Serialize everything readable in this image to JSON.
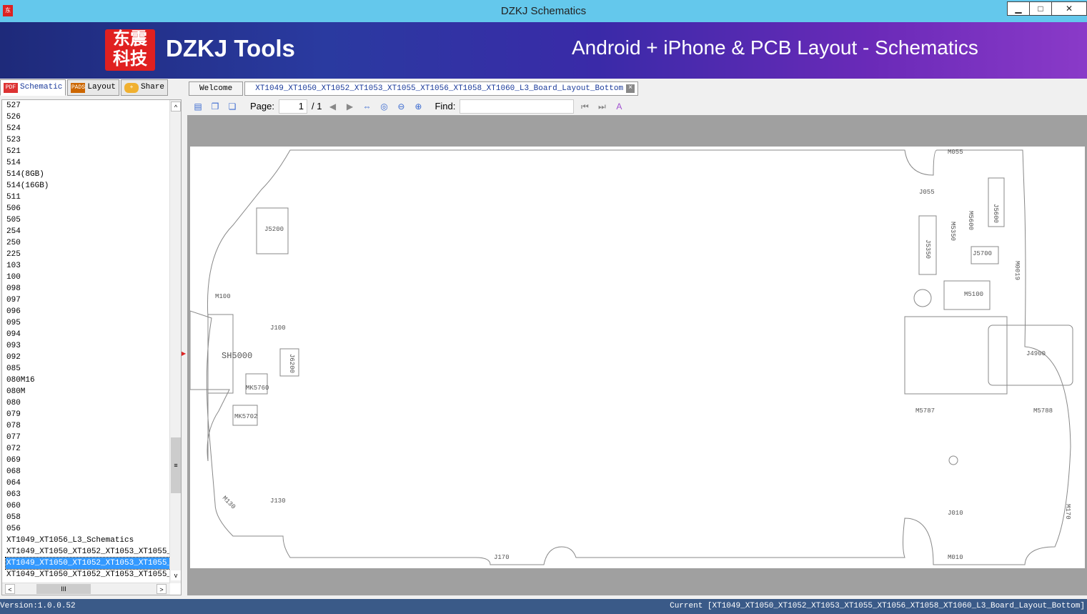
{
  "window": {
    "title": "DZKJ Schematics",
    "app_icon": "dzkj-icon",
    "minimize": "▁",
    "maximize": "□",
    "close": "✕"
  },
  "banner": {
    "logo_text": "东震科技",
    "brand": "DZKJ Tools",
    "slogan": "Android + iPhone & PCB Layout - Schematics"
  },
  "left_tabs": [
    {
      "label": "Schematic",
      "icon": "PDF"
    },
    {
      "label": "Layout",
      "icon": "PADS"
    },
    {
      "label": "Share",
      "icon": "cloud-share"
    }
  ],
  "doc_tabs": [
    {
      "label": "Welcome"
    },
    {
      "label": "XT1049_XT1050_XT1052_XT1053_XT1055_XT1056_XT1058_XT1060_L3_Board_Layout_Bottom"
    }
  ],
  "list_items": [
    "527",
    "526",
    "524",
    "523",
    "521",
    "514",
    "514(8GB)",
    "514(16GB)",
    "511",
    "506",
    "505",
    "254",
    "250",
    "225",
    "103",
    "100",
    "098",
    "097",
    "096",
    "095",
    "094",
    "093",
    "092",
    "085",
    "080M16",
    "080M",
    "080",
    "079",
    "078",
    "077",
    "072",
    "069",
    "068",
    "064",
    "063",
    "060",
    "058",
    "056",
    "XT1049_XT1056_L3_Schematics",
    "XT1049_XT1050_XT1052_XT1053_XT1055_XT1",
    "XT1049_XT1050_XT1052_XT1053_XT1055_XT1",
    "XT1049_XT1050_XT1052_XT1053_XT1055_XT1"
  ],
  "selected_index": 40,
  "toolbar": {
    "page_label": "Page:",
    "page_value": "1",
    "page_total": "/ 1",
    "find_label": "Find:",
    "find_value": ""
  },
  "board_labels": [
    "M055",
    "J055",
    "J5600",
    "M5600",
    "M5350",
    "J5350",
    "J5700",
    "M0019",
    "M5100",
    "J4900",
    "M5787",
    "M5788",
    "J010",
    "M010",
    "M170",
    "J170",
    "J130",
    "M130",
    "MK5702",
    "MK5760",
    "J6200",
    "SH5000",
    "J100",
    "M100",
    "J5200"
  ],
  "status": {
    "version": "Version:1.0.0.52",
    "current": "Current [XT1049_XT1050_XT1052_XT1053_XT1055_XT1056_XT1058_XT1060_L3_Board_Layout_Bottom]"
  }
}
